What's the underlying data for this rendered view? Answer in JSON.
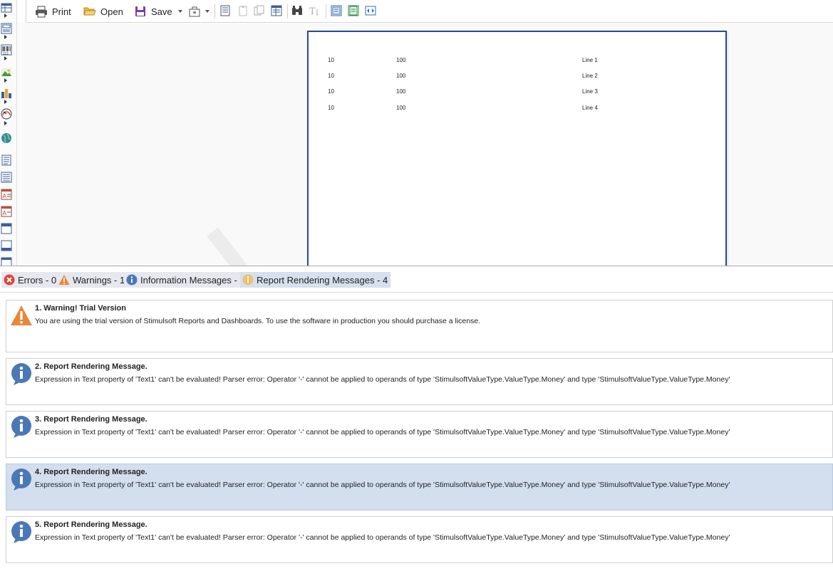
{
  "toolbar": {
    "print_label": "Print",
    "open_label": "Open",
    "save_label": "Save"
  },
  "report": {
    "rows": [
      {
        "col1": "10",
        "col2": "100",
        "col3": "Line 1"
      },
      {
        "col1": "10",
        "col2": "100",
        "col3": "Line 2"
      },
      {
        "col1": "10",
        "col2": "100",
        "col3": "Line 3"
      },
      {
        "col1": "10",
        "col2": "100",
        "col3": "Line 4"
      }
    ]
  },
  "tabs": [
    {
      "label": "Errors - 0",
      "icon": "error-icon"
    },
    {
      "label": "Warnings - 1",
      "icon": "warning-icon"
    },
    {
      "label": "Information Messages - 0",
      "icon": "info-icon"
    },
    {
      "label": "Report Rendering Messages - 4",
      "icon": "rendering-info-icon"
    }
  ],
  "messages": [
    {
      "title": "1. Warning!  Trial Version",
      "text": "You are using the trial version of Stimulsoft Reports and Dashboards. To use the software in production you should purchase a license.",
      "icon": "warning-icon"
    },
    {
      "title": "2. Report Rendering Message.",
      "text": "Expression in Text property of 'Text1' can't be evaluated! Parser error: Operator '-' cannot be applied to operands of type 'StimulsoftValueType.ValueType.Money' and type 'StimulsoftValueType.ValueType.Money'",
      "icon": "info-icon"
    },
    {
      "title": "3. Report Rendering Message.",
      "text": "Expression in Text property of 'Text1' can't be evaluated! Parser error: Operator '-' cannot be applied to operands of type 'StimulsoftValueType.ValueType.Money' and type 'StimulsoftValueType.ValueType.Money'",
      "icon": "info-icon"
    },
    {
      "title": "4. Report Rendering Message.",
      "text": "Expression in Text property of 'Text1' can't be evaluated! Parser error: Operator '-' cannot be applied to operands of type 'StimulsoftValueType.ValueType.Money' and type 'StimulsoftValueType.ValueType.Money'",
      "icon": "info-icon"
    },
    {
      "title": "5. Report Rendering Message.",
      "text": "Expression in Text property of 'Text1' can't be evaluated! Parser error: Operator '-' cannot be applied to operands of type 'StimulsoftValueType.ValueType.Money' and type 'StimulsoftValueType.ValueType.Money'",
      "icon": "info-icon"
    }
  ],
  "colors": {
    "accent": "#2b4b8c",
    "warning": "#e8873a",
    "info": "#4a78b6",
    "error": "#d9463c",
    "selected_row": "#d3dfef"
  }
}
